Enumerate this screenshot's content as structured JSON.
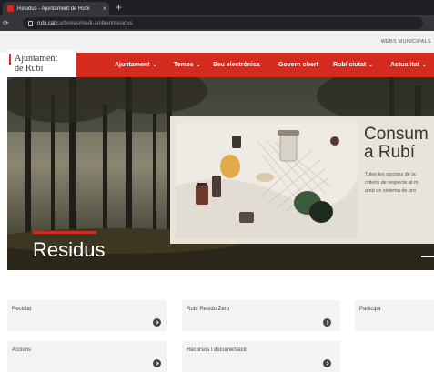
{
  "browser": {
    "tab_title": "Residus - Ajuntament de Rubí",
    "tab_close": "×",
    "new_tab": "+",
    "reload": "⟳",
    "url_host": "rubi.cat",
    "url_path": "/ca/temes/medi-ambient/residus"
  },
  "header": {
    "top_link": "WEBS MUNICIPALS",
    "logo_line1": "Ajuntament",
    "logo_line2": "de Rubí"
  },
  "nav": {
    "items": [
      {
        "label": "Ajuntament",
        "dropdown": true
      },
      {
        "label": "Temes",
        "dropdown": true
      },
      {
        "label": "Seu electrònica",
        "dropdown": false
      },
      {
        "label": "Govern obert",
        "dropdown": false
      },
      {
        "label": "Rubí ciutat",
        "dropdown": true
      },
      {
        "label": "Actualitat",
        "dropdown": true
      }
    ],
    "chevron": "⌄"
  },
  "hero": {
    "title": "Residus",
    "card_title_1": "Consum r",
    "card_title_2": "a Rubí",
    "card_text_1": "Totes les opcions de la",
    "card_text_2": "criteris de respecte al m",
    "card_text_3": "amb un sistema de pro"
  },
  "tiles": [
    {
      "label": "Reciclat"
    },
    {
      "label": "Rubí Residu Zero"
    },
    {
      "label": "Participa"
    },
    {
      "label": "Accions"
    },
    {
      "label": "Recursos i documentació"
    }
  ],
  "colors": {
    "brand_red": "#d52b1e",
    "chrome_dark": "#1e1f22"
  }
}
